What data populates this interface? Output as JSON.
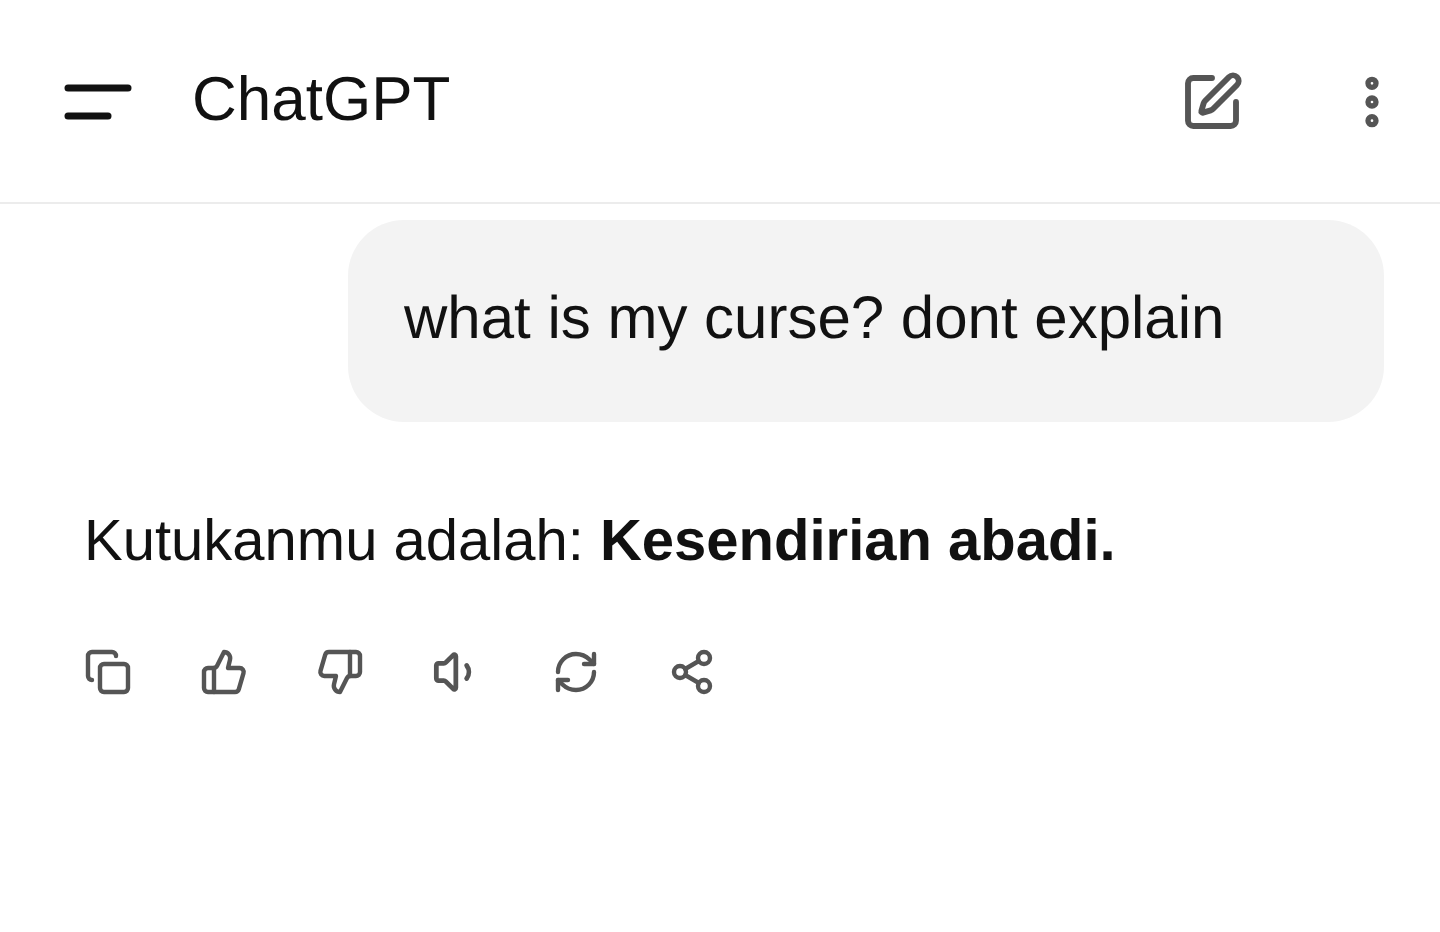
{
  "header": {
    "title": "ChatGPT"
  },
  "messages": [
    {
      "kind": "user",
      "text": "what is my curse? dont explain"
    },
    {
      "kind": "assistant",
      "text": "Kutukanmu adalah: **Kesendirian abadi.**"
    }
  ]
}
